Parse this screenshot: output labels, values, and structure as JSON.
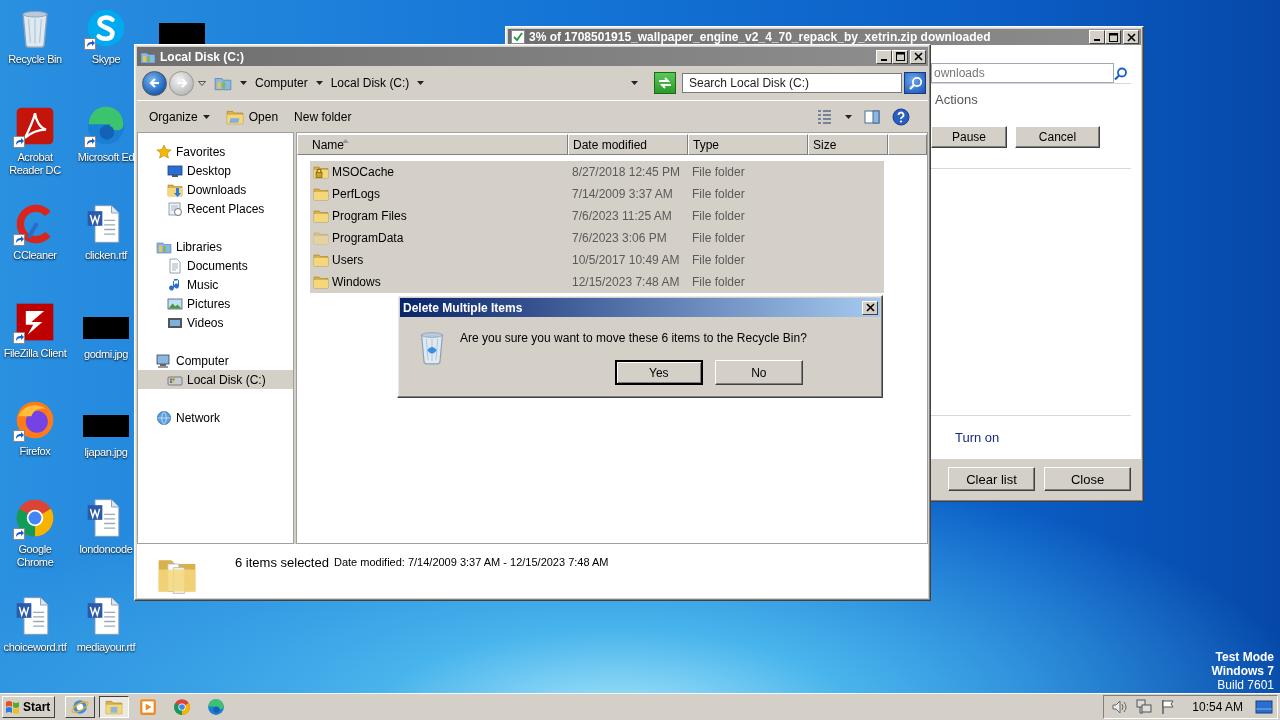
{
  "desktop": {
    "icons": [
      {
        "label": "Recycle Bin",
        "kind": "recycle",
        "shortcut": false
      },
      {
        "label": "Acrobat Reader DC",
        "kind": "acrobat",
        "shortcut": true
      },
      {
        "label": "CCleaner",
        "kind": "ccleaner",
        "shortcut": true
      },
      {
        "label": "FileZilla Client",
        "kind": "filezilla",
        "shortcut": true
      },
      {
        "label": "Firefox",
        "kind": "firefox",
        "shortcut": true
      },
      {
        "label": "Google Chrome",
        "kind": "chrome",
        "shortcut": true
      },
      {
        "label": "choiceword.rtf",
        "kind": "word",
        "shortcut": false
      },
      {
        "label": "Skype",
        "kind": "skype",
        "shortcut": true
      },
      {
        "label": "Microsoft Ed",
        "kind": "edge",
        "shortcut": true
      },
      {
        "label": "clicken.rtf",
        "kind": "word",
        "shortcut": false
      },
      {
        "label": "godmi.jpg",
        "kind": "redacted",
        "shortcut": false
      },
      {
        "label": "ljapan.jpg",
        "kind": "redacted",
        "shortcut": false
      },
      {
        "label": "londoncode",
        "kind": "word",
        "shortcut": false
      },
      {
        "label": "mediayour.rtf",
        "kind": "word",
        "shortcut": false
      },
      {
        "kind": "redacted",
        "shortcut": false
      }
    ]
  },
  "download_window": {
    "title": "3% of 1708501915_wallpaper_engine_v2_4_70_repack_by_xetrin.zip downloaded",
    "active": false,
    "search": {
      "placeholder": "ownloads"
    },
    "section": "Actions",
    "buttons": [
      "Pause",
      "Cancel"
    ],
    "link": "Turn on",
    "footer_buttons": [
      "Clear list",
      "Close"
    ]
  },
  "explorer": {
    "title": "Local Disk (C:)",
    "active": false,
    "breadcrumb": [
      "Computer",
      "Local Disk (C:)"
    ],
    "search": {
      "placeholder": "Search Local Disk (C:)"
    },
    "toolbar": [
      {
        "label": "Organize",
        "kind": "menu"
      },
      {
        "label": "Open",
        "kind": "open"
      },
      {
        "label": "New folder",
        "kind": "plain"
      }
    ],
    "nav": [
      {
        "label": "Favorites",
        "kind": "star",
        "selected": false,
        "children": [
          {
            "label": "Desktop",
            "kind": "desktop",
            "selected": false
          },
          {
            "label": "Downloads",
            "kind": "downloads",
            "selected": false
          },
          {
            "label": "Recent Places",
            "kind": "recent",
            "selected": false
          }
        ]
      },
      {
        "label": "Libraries",
        "kind": "library",
        "selected": false,
        "children": [
          {
            "label": "Documents",
            "kind": "document",
            "selected": false
          },
          {
            "label": "Music",
            "kind": "music",
            "selected": false
          },
          {
            "label": "Pictures",
            "kind": "picture",
            "selected": false
          },
          {
            "label": "Videos",
            "kind": "video",
            "selected": false
          }
        ]
      },
      {
        "label": "Computer",
        "kind": "computer",
        "selected": false,
        "children": [
          {
            "label": "Local Disk (C:)",
            "kind": "disk",
            "selected": true
          }
        ]
      },
      {
        "label": "Network",
        "kind": "network",
        "selected": false
      }
    ],
    "columns": [
      {
        "label": "Name",
        "sorted": true
      },
      {
        "label": "Date modified",
        "sorted": false
      },
      {
        "label": "Type",
        "sorted": false
      },
      {
        "label": "Size",
        "sorted": false
      }
    ],
    "rows": [
      {
        "name": "MSOCache",
        "date": "8/27/2018 12:45 PM",
        "type": "File folder",
        "kind": "locked",
        "selected": true
      },
      {
        "name": "PerfLogs",
        "date": "7/14/2009 3:37 AM",
        "type": "File folder",
        "kind": "folder",
        "selected": true
      },
      {
        "name": "Program Files",
        "date": "7/6/2023 11:25 AM",
        "type": "File folder",
        "kind": "folder",
        "selected": true
      },
      {
        "name": "ProgramData",
        "date": "7/6/2023 3:06 PM",
        "type": "File folder",
        "kind": "hidden",
        "selected": true
      },
      {
        "name": "Users",
        "date": "10/5/2017 10:49 AM",
        "type": "File folder",
        "kind": "folder",
        "selected": true
      },
      {
        "name": "Windows",
        "date": "12/15/2023 7:48 AM",
        "type": "File folder",
        "kind": "folder",
        "selected": true
      }
    ],
    "details": {
      "count": "6 items selected",
      "info": "Date modified: 7/14/2009 3:37 AM - 12/15/2023 7:48 AM"
    }
  },
  "dialog": {
    "title": "Delete Multiple Items",
    "active": true,
    "message": "Are you sure you want to move these 6 items to the Recycle Bin?",
    "buttons": [
      {
        "label": "Yes",
        "default": true
      },
      {
        "label": "No",
        "default": false
      }
    ]
  },
  "os_info": [
    {
      "text": "Test Mode",
      "bold": true
    },
    {
      "text": "Windows 7",
      "bold": true
    },
    {
      "text": "Build 7601",
      "bold": false
    }
  ],
  "taskbar": {
    "start": "Start",
    "apps": [
      {
        "kind": "ie",
        "framed": true,
        "pressed": false
      },
      {
        "kind": "explorer",
        "framed": true,
        "pressed": true
      },
      {
        "kind": "media",
        "framed": false,
        "pressed": false
      },
      {
        "kind": "chrome",
        "framed": false,
        "pressed": false
      },
      {
        "kind": "edge",
        "framed": false,
        "pressed": false
      }
    ],
    "clock": "10:54 AM"
  }
}
